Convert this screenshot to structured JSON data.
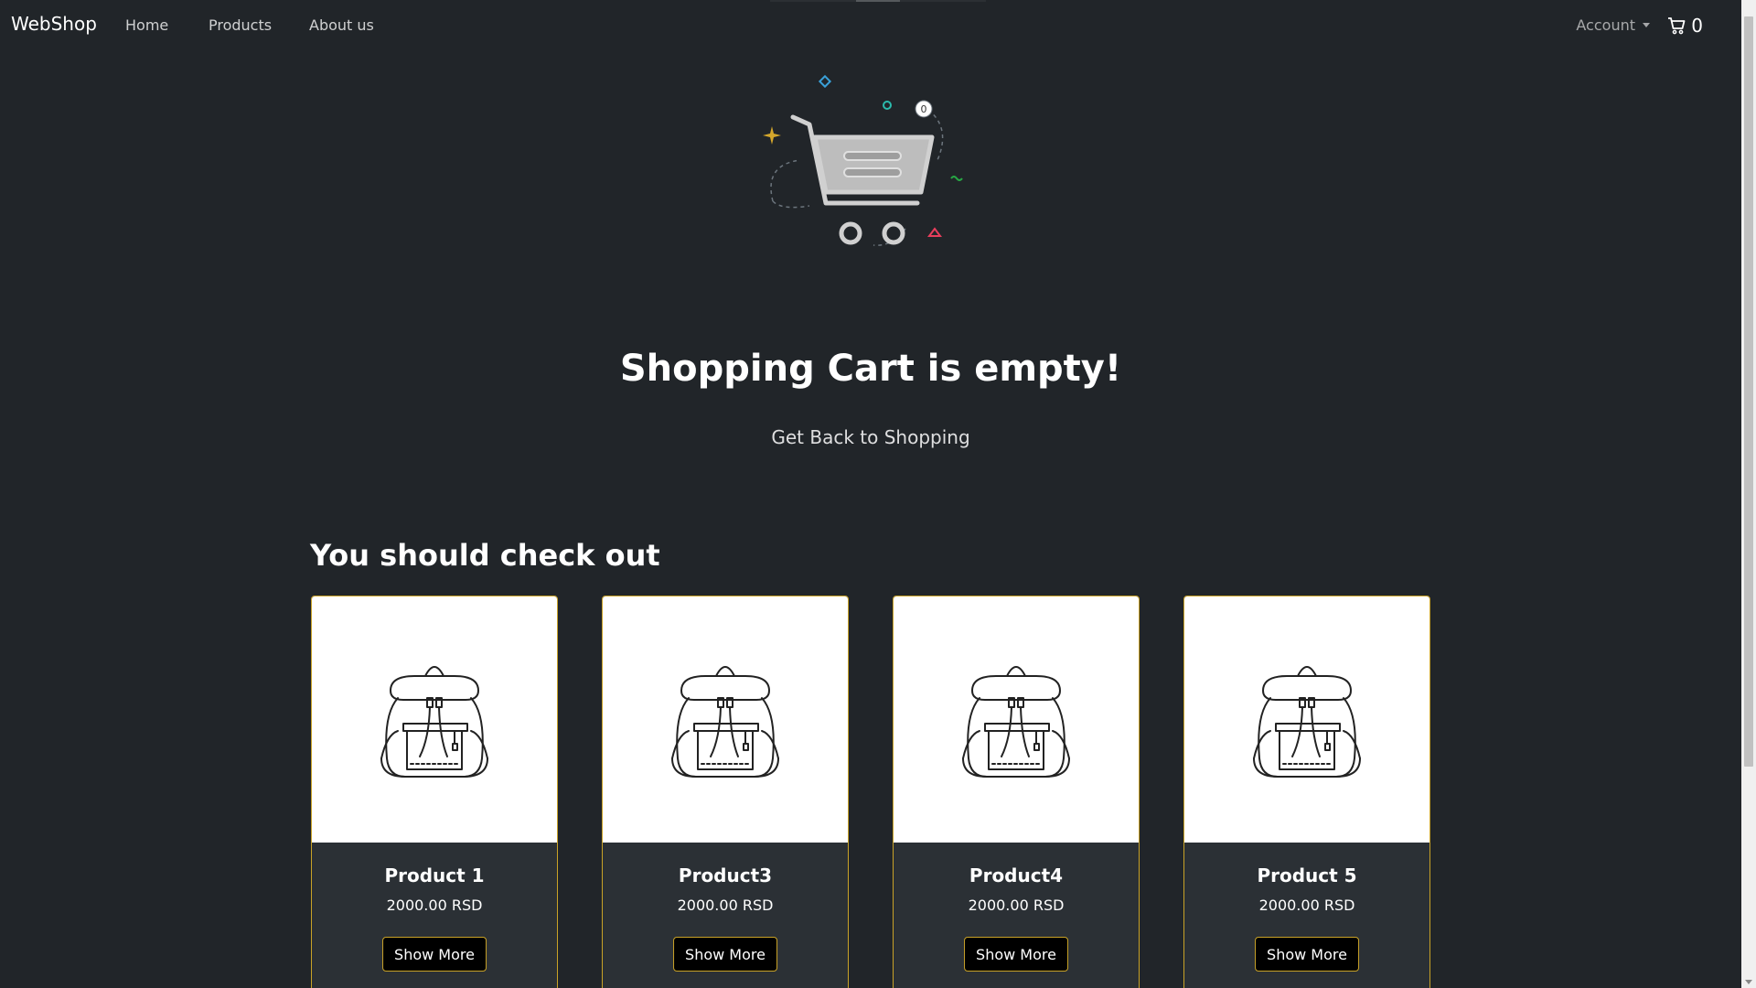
{
  "navbar": {
    "brand": "WebShop",
    "links": [
      "Home",
      "Products",
      "About us"
    ],
    "account_label": "Account",
    "cart_count": "0"
  },
  "hero": {
    "illustration_badge": "0",
    "title": "Shopping Cart is empty!",
    "link_label": "Get Back to Shopping"
  },
  "recommendations": {
    "title": "You should check out",
    "products": [
      {
        "name": "Product 1",
        "price": "2000.00 RSD",
        "button": "Show More",
        "icon": "backpack-icon"
      },
      {
        "name": "Product3",
        "price": "2000.00 RSD",
        "button": "Show More",
        "icon": "backpack-icon"
      },
      {
        "name": "Product4",
        "price": "2000.00 RSD",
        "button": "Show More",
        "icon": "backpack-icon"
      },
      {
        "name": "Product 5",
        "price": "2000.00 RSD",
        "button": "Show More",
        "icon": "backpack-icon"
      }
    ]
  },
  "colors": {
    "background": "#212529",
    "card_border": "#c9a227",
    "button_bg": "#000000"
  }
}
